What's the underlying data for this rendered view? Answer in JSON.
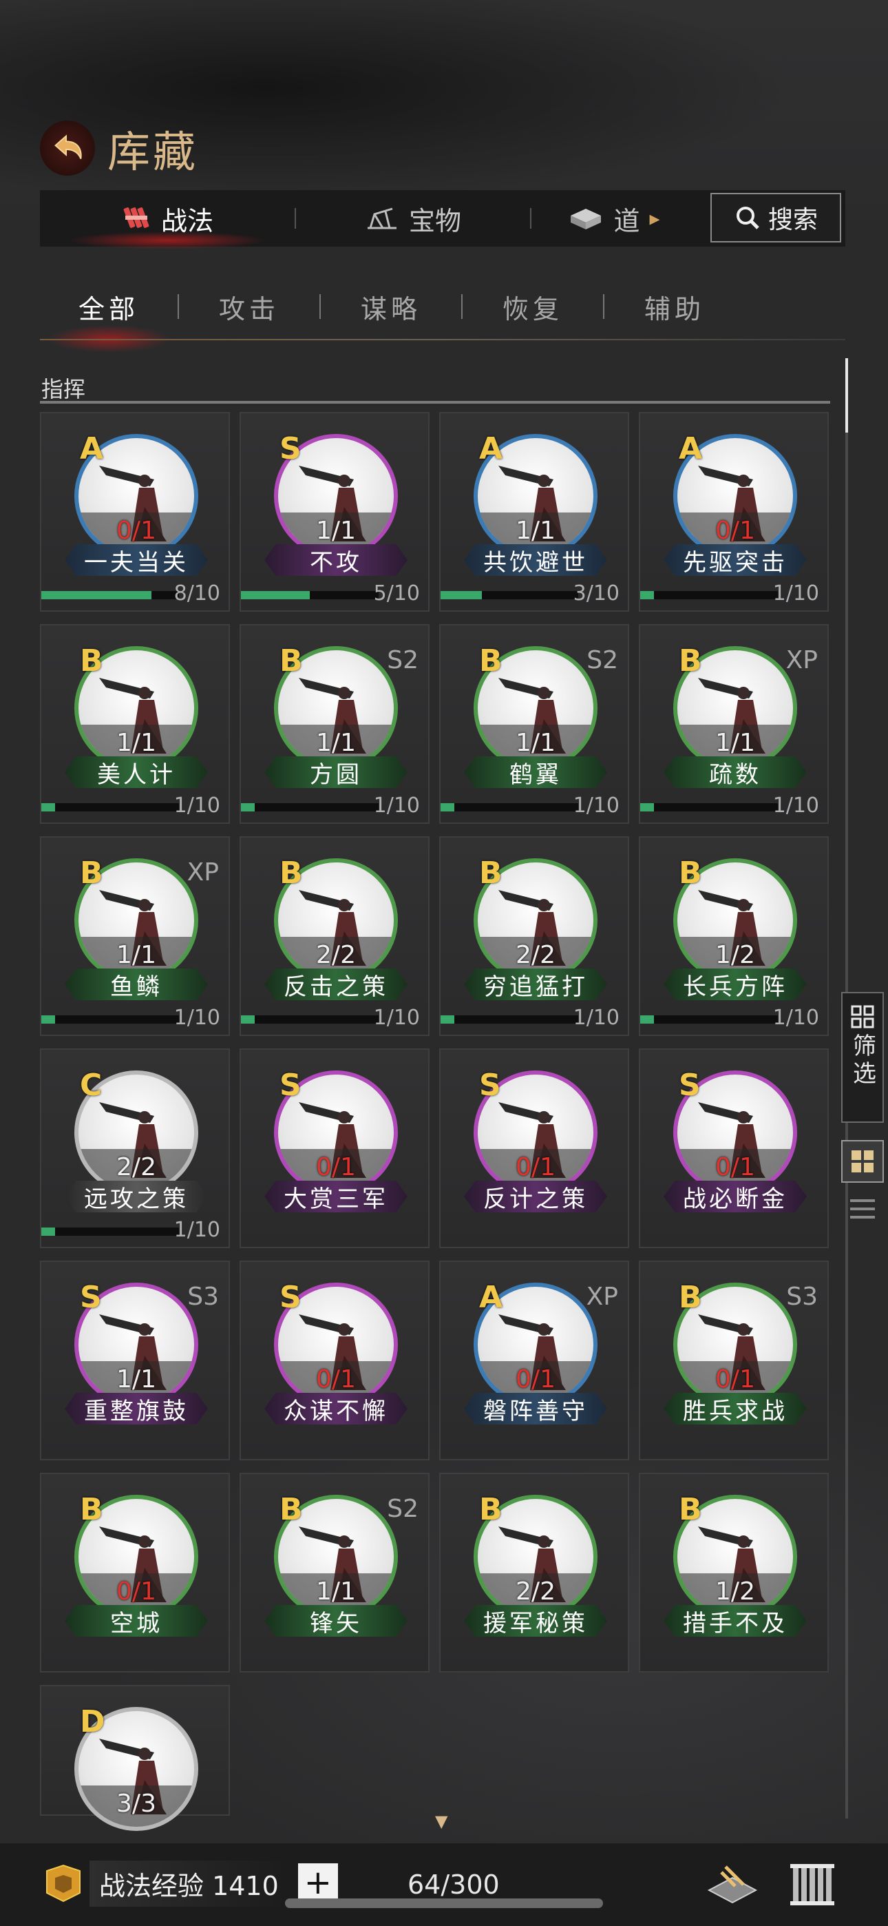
{
  "header": {
    "title": "库藏"
  },
  "top_tabs": [
    {
      "label": "战法",
      "icon": "bundle-icon",
      "active": true
    },
    {
      "label": "宝物",
      "icon": "treasure-icon",
      "active": false
    },
    {
      "label": "道",
      "icon": "item-icon",
      "active": false
    }
  ],
  "search": {
    "label": "搜索"
  },
  "sub_tabs": [
    {
      "label": "全部",
      "active": true
    },
    {
      "label": "攻击",
      "active": false
    },
    {
      "label": "谋略",
      "active": false
    },
    {
      "label": "恢复",
      "active": false
    },
    {
      "label": "辅助",
      "active": false
    }
  ],
  "section": {
    "label": "指挥"
  },
  "cards": [
    {
      "grade": "A",
      "name": "一夫当关",
      "count": "0/1",
      "season": "",
      "ring": "blue",
      "progress": "8/10",
      "fill": 0.8
    },
    {
      "grade": "S",
      "name": "不攻",
      "count": "1/1",
      "season": "",
      "ring": "purple",
      "progress": "5/10",
      "fill": 0.5
    },
    {
      "grade": "A",
      "name": "共饮避世",
      "count": "1/1",
      "season": "",
      "ring": "blue",
      "progress": "3/10",
      "fill": 0.3
    },
    {
      "grade": "A",
      "name": "先驱突击",
      "count": "0/1",
      "season": "",
      "ring": "blue",
      "progress": "1/10",
      "fill": 0.1
    },
    {
      "grade": "B",
      "name": "美人计",
      "count": "1/1",
      "season": "",
      "ring": "green",
      "progress": "1/10",
      "fill": 0.1
    },
    {
      "grade": "B",
      "name": "方圆",
      "count": "1/1",
      "season": "S2",
      "ring": "green",
      "progress": "1/10",
      "fill": 0.1
    },
    {
      "grade": "B",
      "name": "鹤翼",
      "count": "1/1",
      "season": "S2",
      "ring": "green",
      "progress": "1/10",
      "fill": 0.1
    },
    {
      "grade": "B",
      "name": "疏数",
      "count": "1/1",
      "season": "XP",
      "ring": "green",
      "progress": "1/10",
      "fill": 0.1
    },
    {
      "grade": "B",
      "name": "鱼鳞",
      "count": "1/1",
      "season": "XP",
      "ring": "green",
      "progress": "1/10",
      "fill": 0.1
    },
    {
      "grade": "B",
      "name": "反击之策",
      "count": "2/2",
      "season": "",
      "ring": "green",
      "progress": "1/10",
      "fill": 0.1
    },
    {
      "grade": "B",
      "name": "穷追猛打",
      "count": "2/2",
      "season": "",
      "ring": "green",
      "progress": "1/10",
      "fill": 0.1
    },
    {
      "grade": "B",
      "name": "长兵方阵",
      "count": "1/2",
      "season": "",
      "ring": "green",
      "progress": "1/10",
      "fill": 0.1
    },
    {
      "grade": "C",
      "name": "远攻之策",
      "count": "2/2",
      "season": "",
      "ring": "gray",
      "progress": "1/10",
      "fill": 0.1
    },
    {
      "grade": "S",
      "name": "大赏三军",
      "count": "0/1",
      "season": "",
      "ring": "purple",
      "progress": "",
      "fill": 0
    },
    {
      "grade": "S",
      "name": "反计之策",
      "count": "0/1",
      "season": "",
      "ring": "purple",
      "progress": "",
      "fill": 0
    },
    {
      "grade": "S",
      "name": "战必断金",
      "count": "0/1",
      "season": "",
      "ring": "purple",
      "progress": "",
      "fill": 0
    },
    {
      "grade": "S",
      "name": "重整旗鼓",
      "count": "1/1",
      "season": "S3",
      "ring": "purple",
      "progress": "",
      "fill": 0
    },
    {
      "grade": "S",
      "name": "众谋不懈",
      "count": "0/1",
      "season": "",
      "ring": "purple",
      "progress": "",
      "fill": 0
    },
    {
      "grade": "A",
      "name": "磐阵善守",
      "count": "0/1",
      "season": "XP",
      "ring": "blue",
      "progress": "",
      "fill": 0
    },
    {
      "grade": "B",
      "name": "胜兵求战",
      "count": "0/1",
      "season": "S3",
      "ring": "green",
      "progress": "",
      "fill": 0
    },
    {
      "grade": "B",
      "name": "空城",
      "count": "0/1",
      "season": "",
      "ring": "green",
      "progress": "",
      "fill": 0
    },
    {
      "grade": "B",
      "name": "锋矢",
      "count": "1/1",
      "season": "S2",
      "ring": "green",
      "progress": "",
      "fill": 0
    },
    {
      "grade": "B",
      "name": "援军秘策",
      "count": "2/2",
      "season": "",
      "ring": "green",
      "progress": "",
      "fill": 0
    },
    {
      "grade": "B",
      "name": "措手不及",
      "count": "1/2",
      "season": "",
      "ring": "green",
      "progress": "",
      "fill": 0
    },
    {
      "grade": "D",
      "name": "",
      "count": "3/3",
      "season": "",
      "ring": "gray",
      "progress": "",
      "fill": 0
    }
  ],
  "side": {
    "filter_label": "筛选"
  },
  "bottom": {
    "exp_label": "战法经验 1410",
    "plus": "+",
    "capacity": "64/300"
  },
  "colors": {
    "ring_blue": "#3d7bb4",
    "ring_purple": "#b04ab8",
    "ring_green": "#4f9a4a",
    "ring_gray": "#b8b8b8",
    "grade_gold": "#f2c84a",
    "zero_red": "#e0322d",
    "progress_green": "#3aa86a",
    "title_gold": "#d9b98a"
  }
}
